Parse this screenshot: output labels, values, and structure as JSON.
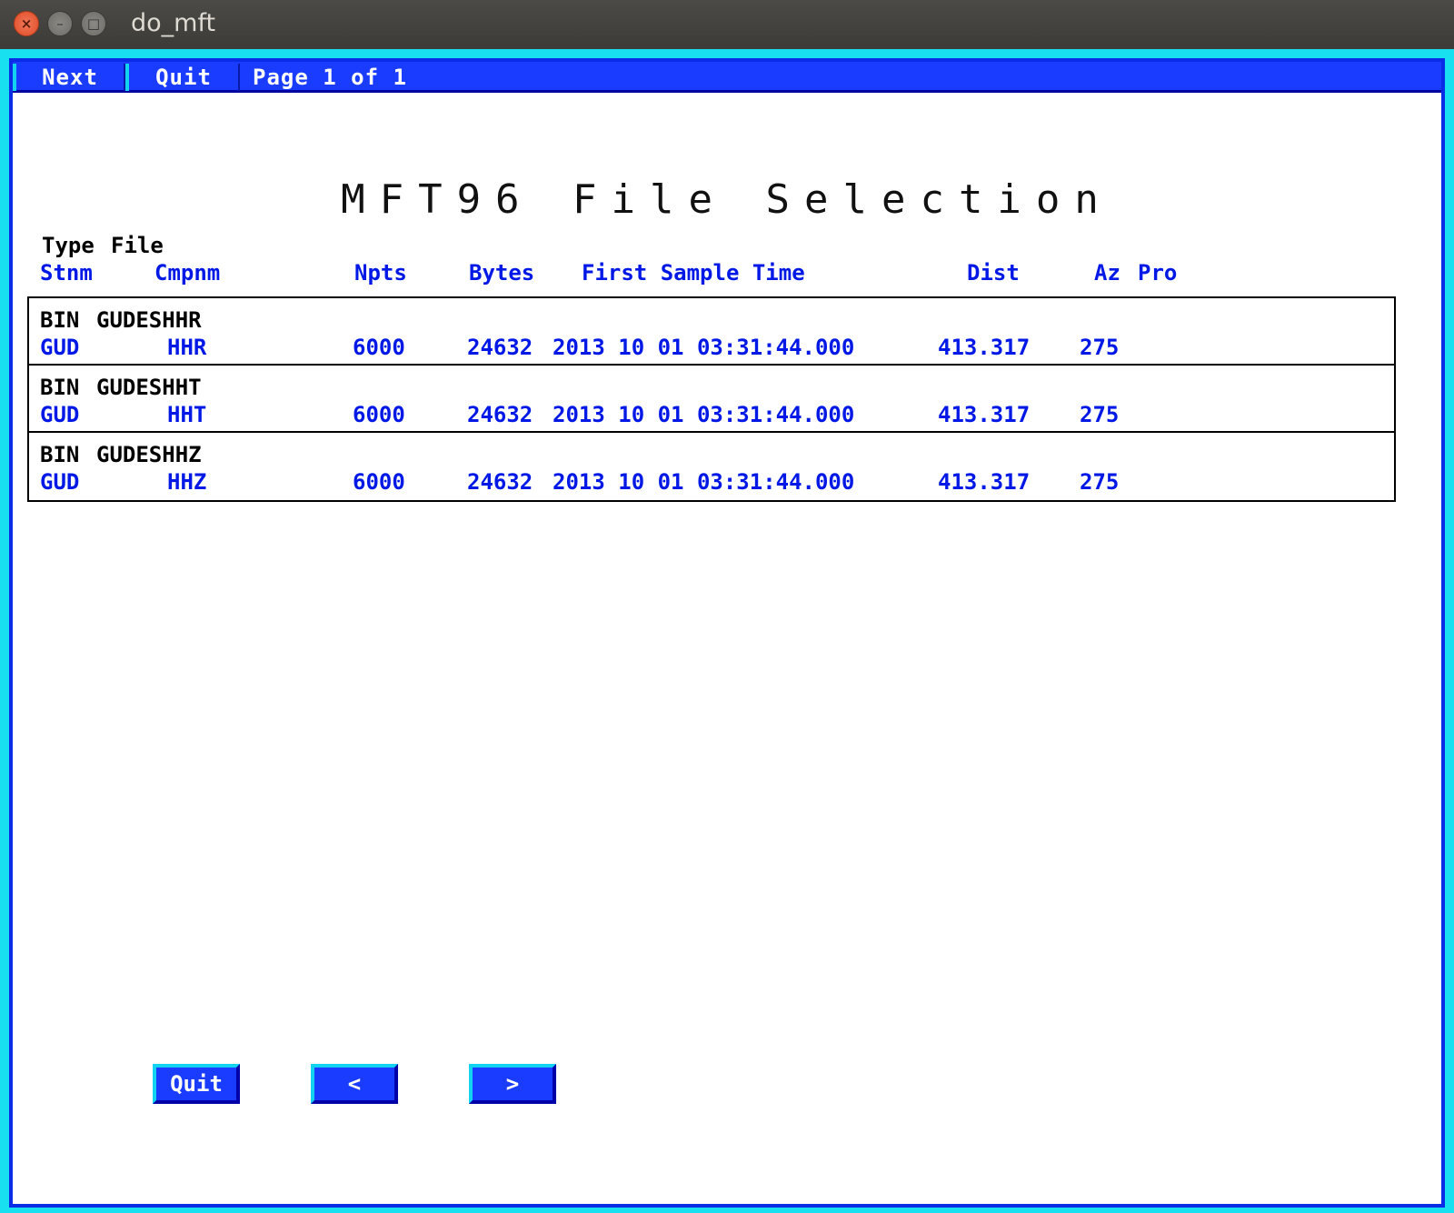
{
  "window": {
    "title": "do_mft",
    "close_glyph": "×",
    "min_glyph": "–",
    "max_glyph": "□"
  },
  "menu": {
    "next_label": "Next",
    "quit_label": "Quit",
    "page_info": "Page 1 of 1"
  },
  "title": "MFT96 File Selection",
  "headers": {
    "type": "Type",
    "file": "File",
    "stnm": "Stnm",
    "cmpnm": "Cmpnm",
    "npts": "Npts",
    "bytes": "Bytes",
    "first_sample_time": "First Sample Time",
    "dist": "Dist",
    "az": "Az",
    "pro": "Pro"
  },
  "rows": [
    {
      "type": "BIN",
      "file": "GUDESHHR",
      "stnm": "GUD",
      "cmpnm": "HHR",
      "npts": "6000",
      "bytes": "24632",
      "time": "2013 10 01 03:31:44.000",
      "dist": "413.317",
      "az": "275"
    },
    {
      "type": "BIN",
      "file": "GUDESHHT",
      "stnm": "GUD",
      "cmpnm": "HHT",
      "npts": "6000",
      "bytes": "24632",
      "time": "2013 10 01 03:31:44.000",
      "dist": "413.317",
      "az": "275"
    },
    {
      "type": "BIN",
      "file": "GUDESHHZ",
      "stnm": "GUD",
      "cmpnm": "HHZ",
      "npts": "6000",
      "bytes": "24632",
      "time": "2013 10 01 03:31:44.000",
      "dist": "413.317",
      "az": "275"
    }
  ],
  "bottom": {
    "quit_label": "Quit",
    "prev_label": "<",
    "next_label": ">"
  },
  "colors": {
    "frame": "#19e0f0",
    "accent_blue": "#1a3cff",
    "text_blue": "#0018e6"
  }
}
